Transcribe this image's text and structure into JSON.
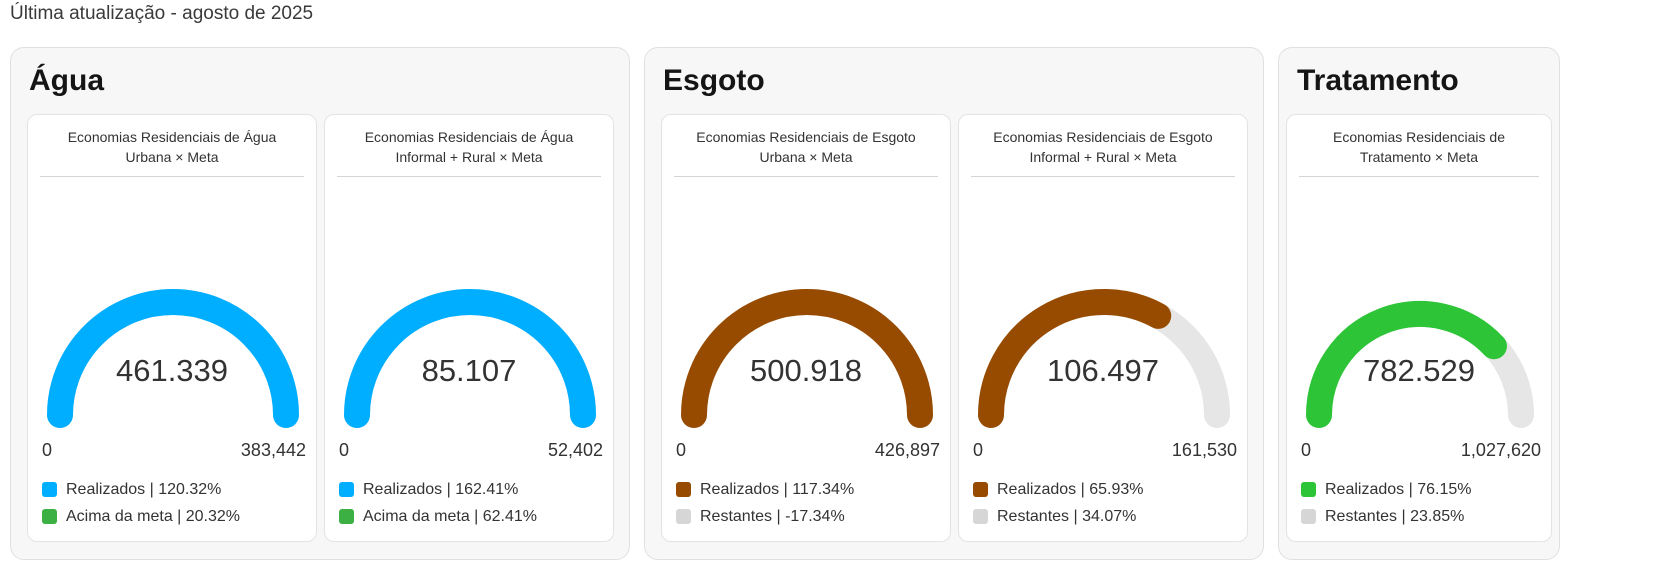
{
  "header": {
    "updated": "Última atualização - agosto de 2025"
  },
  "colors": {
    "water": "#00AEFF",
    "above": "#3CB043",
    "sewage": "#964B00",
    "treatment": "#2DC437",
    "remaining": "#E6E6E6",
    "remaining_swatch": "#D6D6D6"
  },
  "groups": [
    {
      "title": "Água",
      "cards": [
        {
          "title_lines": [
            "Economias Residenciais de Água",
            "Urbana × Meta"
          ],
          "value": "461.339",
          "min": "0",
          "max": "383,442",
          "fill": 1.0,
          "color": "#00AEFF",
          "legend": [
            {
              "label": "Realizados | 120.32%",
              "color": "#00AEFF"
            },
            {
              "label": "Acima da meta | 20.32%",
              "color": "#3CB043"
            }
          ]
        },
        {
          "title_lines": [
            "Economias Residenciais de Água",
            "Informal + Rural × Meta"
          ],
          "value": "85.107",
          "min": "0",
          "max": "52,402",
          "fill": 1.0,
          "color": "#00AEFF",
          "legend": [
            {
              "label": "Realizados | 162.41%",
              "color": "#00AEFF"
            },
            {
              "label": "Acima da meta | 62.41%",
              "color": "#3CB043"
            }
          ]
        }
      ]
    },
    {
      "title": "Esgoto",
      "cards": [
        {
          "title_lines": [
            "Economias Residenciais de Esgoto",
            "Urbana × Meta"
          ],
          "value": "500.918",
          "min": "0",
          "max": "426,897",
          "fill": 1.0,
          "color": "#964B00",
          "legend": [
            {
              "label": "Realizados | 117.34%",
              "color": "#964B00"
            },
            {
              "label": "Restantes | -17.34%",
              "color": "#D6D6D6"
            }
          ]
        },
        {
          "title_lines": [
            "Economias Residenciais de Esgoto",
            "Informal + Rural × Meta"
          ],
          "value": "106.497",
          "min": "0",
          "max": "161,530",
          "fill": 0.6593,
          "color": "#964B00",
          "legend": [
            {
              "label": "Realizados | 65.93%",
              "color": "#964B00"
            },
            {
              "label": "Restantes | 34.07%",
              "color": "#D6D6D6"
            }
          ]
        }
      ]
    },
    {
      "title": "Tratamento",
      "cards": [
        {
          "title_lines": [
            "Economias Residenciais de",
            "Tratamento × Meta"
          ],
          "value": "782.529",
          "min": "0",
          "max": "1,027,620",
          "fill": 0.7615,
          "color": "#2DC437",
          "legend": [
            {
              "label": "Realizados | 76.15%",
              "color": "#2DC437"
            },
            {
              "label": "Restantes | 23.85%",
              "color": "#D6D6D6"
            }
          ]
        }
      ]
    }
  ]
}
